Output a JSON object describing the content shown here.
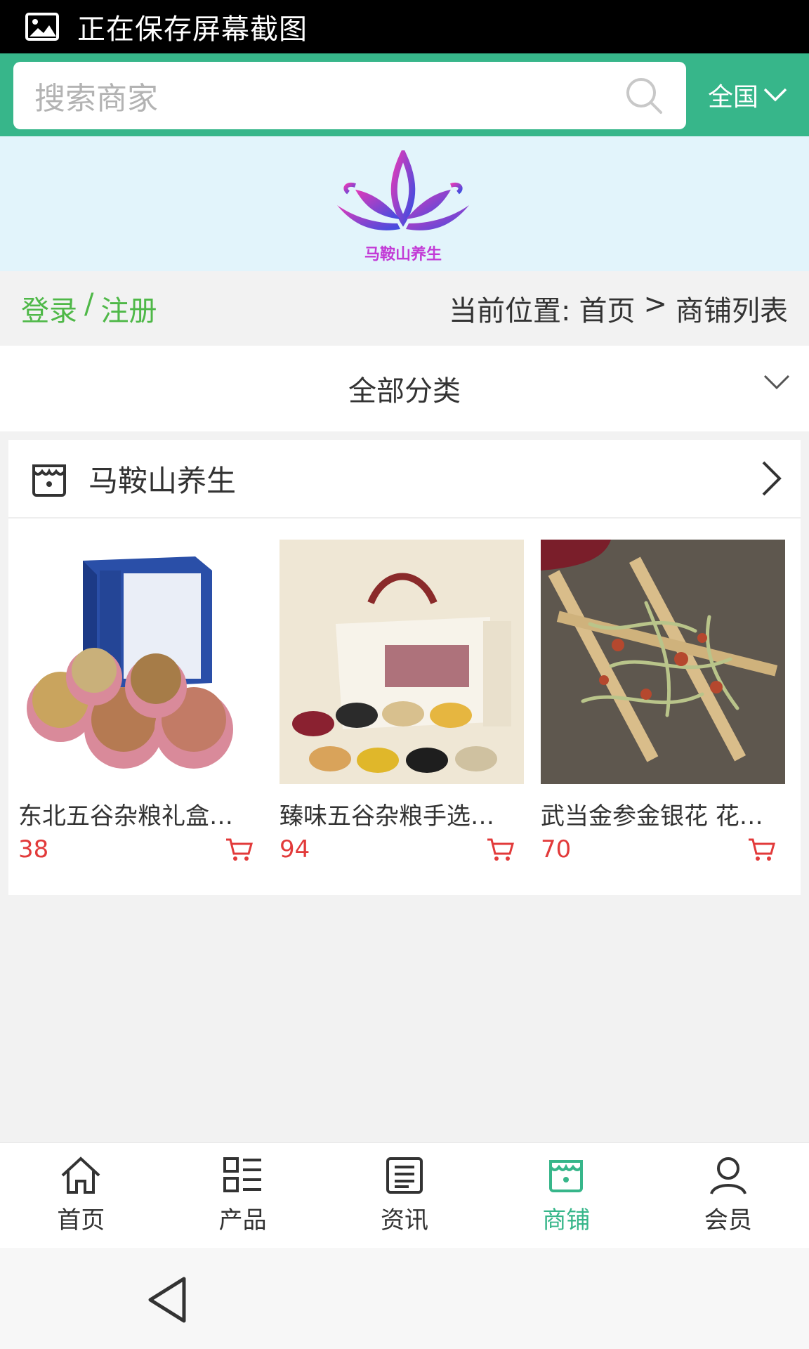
{
  "status_bar": {
    "text": "正在保存屏幕截图"
  },
  "header": {
    "search_placeholder": "搜索商家",
    "region_label": "全国"
  },
  "banner": {
    "logo_text": "马鞍山养生"
  },
  "crumbs": {
    "login": "登录",
    "sep": "/",
    "register": "注册",
    "location_label": "当前位置:",
    "home": "首页",
    "arrow": ">",
    "current": "商铺列表"
  },
  "category": {
    "label": "全部分类"
  },
  "shop": {
    "name": "马鞍山养生",
    "products": [
      {
        "title": "东北五谷杂粮礼盒…",
        "price": "38"
      },
      {
        "title": "臻味五谷杂粮手选…",
        "price": "94"
      },
      {
        "title": "武当金参金银花 花…",
        "price": "70"
      }
    ]
  },
  "tabbar": {
    "items": [
      {
        "label": "首页"
      },
      {
        "label": "产品"
      },
      {
        "label": "资讯"
      },
      {
        "label": "商铺"
      },
      {
        "label": "会员"
      }
    ]
  },
  "colors": {
    "accent": "#37b68a",
    "login_green": "#4fb848",
    "price_red": "#e23a3a"
  }
}
